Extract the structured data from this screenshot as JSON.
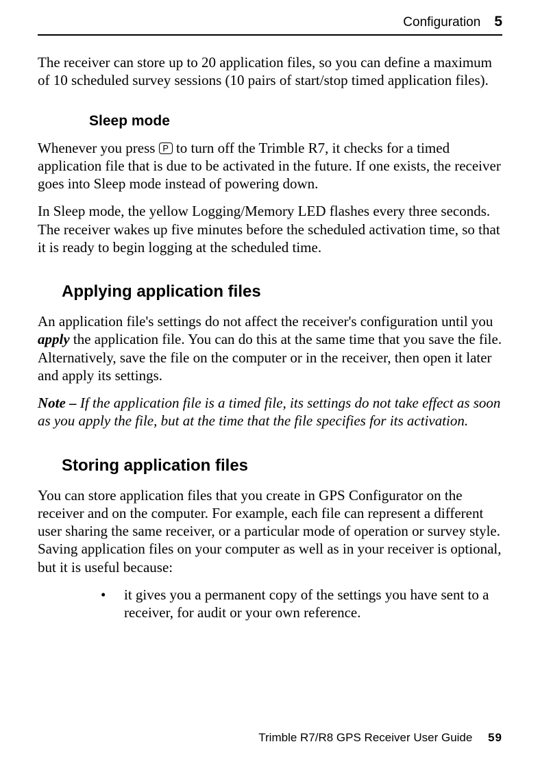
{
  "header": {
    "title": "Configuration",
    "chapter_number": "5"
  },
  "intro_para": "The receiver can store up to 20 application files, so you can define a maximum of 10 scheduled survey sessions (10 pairs of start/stop timed application files).",
  "sleep_mode": {
    "heading": "Sleep mode",
    "p1_a": "Whenever you press ",
    "key": "P",
    "p1_b": " to turn off the Trimble R7, it checks for a timed application file that is due to be activated in the future. If one exists, the receiver goes into Sleep mode instead of powering down.",
    "p2": "In Sleep mode, the yellow Logging/Memory LED flashes every three seconds. The receiver wakes up five minutes before the scheduled activation time, so that it is ready to begin logging at the scheduled time."
  },
  "applying": {
    "heading": "Applying application files",
    "p1_a": "An application file's settings do not affect the receiver's configuration until you ",
    "p1_em": "apply",
    "p1_b": " the application file. You can do this at the same time that you save the file. Alternatively, save the file on the computer or in the receiver, then open it later and apply its settings.",
    "note_label": "Note – ",
    "note_body": "If the application file is a timed file, its settings do not take effect as soon as you apply the file, but at the time that the file specifies for its activation."
  },
  "storing": {
    "heading": "Storing application files",
    "p1": "You can store application files that you create in GPS Configurator on the receiver and on the computer. For example, each file can represent a different user sharing the same receiver, or a particular mode of operation or survey style. Saving application files on your computer as well as in your receiver is optional, but it is useful because:",
    "bullet1": "it gives you a permanent copy of the settings you have sent to a receiver, for audit or your own reference."
  },
  "footer": {
    "book": "Trimble R7/R8 GPS Receiver User Guide",
    "page": "59"
  }
}
